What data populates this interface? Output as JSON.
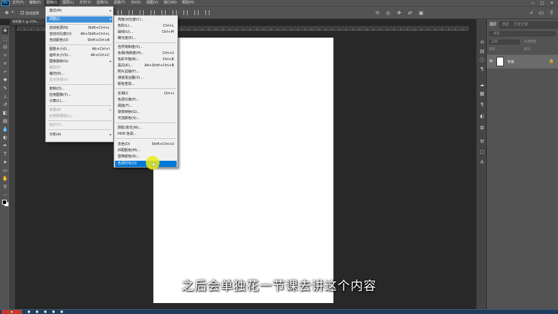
{
  "app": {
    "logo": "Ps",
    "doc_tab": "未标题-1 @ 25%..."
  },
  "menubar": {
    "items": [
      "文件(F)",
      "编辑(E)",
      "图像(I)",
      "图层(L)",
      "文字(Y)",
      "选择(S)",
      "滤镜(T)",
      "3D(D)",
      "视图(V)",
      "窗口(W)",
      "帮助(H)"
    ],
    "active_index": 2
  },
  "window_controls": {
    "minimize": "—",
    "maximize": "□",
    "close": "✕"
  },
  "options_bar": {
    "auto_select_label": "自动选择"
  },
  "image_menu": {
    "mode": "模式(M)",
    "adjustments": "调整(J)",
    "auto_tone": "自动色调(N)",
    "auto_tone_sc": "Shift+Ctrl+L",
    "auto_contrast": "自动对比度(U)",
    "auto_contrast_sc": "Alt+Shift+Ctrl+L",
    "auto_color": "自动颜色(O)",
    "auto_color_sc": "Shift+Ctrl+B",
    "image_size": "图像大小(I)...",
    "image_size_sc": "Alt+Ctrl+I",
    "canvas_size": "画布大小(S)...",
    "canvas_size_sc": "Alt+Ctrl+C",
    "rotation": "图像旋转(G)",
    "crop": "裁剪(P)",
    "trim": "裁切(R)...",
    "reveal_all": "显示全部(V)",
    "duplicate": "复制(D)...",
    "apply_image": "应用图像(Y)...",
    "calculations": "计算(C)...",
    "variables": "变量(B)",
    "apply_data": "应用数据组(L)...",
    "trap": "陷印(T)...",
    "analysis": "分析(A)"
  },
  "adjust_menu": {
    "brightness": "亮度/对比度(C)...",
    "levels": "色阶(L)...",
    "levels_sc": "Ctrl+L",
    "curves": "曲线(U)...",
    "curves_sc": "Ctrl+M",
    "exposure": "曝光度(E)...",
    "vibrance": "自然饱和度(V)...",
    "hue_sat": "色相/饱和度(H)...",
    "hue_sat_sc": "Ctrl+U",
    "color_balance": "色彩平衡(B)...",
    "color_balance_sc": "Ctrl+B",
    "bw": "黑白(K)...",
    "bw_sc": "Alt+Shift+Ctrl+B",
    "photo_filter": "照片滤镜(F)...",
    "channel_mixer": "通道混合器(X)...",
    "color_lookup": "颜色查找...",
    "invert": "反相(I)",
    "invert_sc": "Ctrl+I",
    "posterize": "色调分离(P)...",
    "threshold": "阈值(T)...",
    "gradient_map": "渐变映射(G)...",
    "selective_color": "可选颜色(S)...",
    "shadows": "阴影/高光(W)...",
    "hdr": "HDR 色调...",
    "desaturate": "去色(D)",
    "desaturate_sc": "Shift+Ctrl+U",
    "match_color": "匹配颜色(M)...",
    "replace_color": "替换颜色(R)...",
    "equalize": "色调均化(Q)"
  },
  "layers_panel": {
    "tabs": [
      "图层",
      "通道",
      "历史记录"
    ],
    "search": "类型",
    "mode": "正常",
    "opacity": "不透明度:",
    "lock": "锁定:",
    "fill": "填充:",
    "layer_name": "背景"
  },
  "subtitle": "之后会单独花一节课去讲这个内容",
  "colors": {
    "highlight": "#0078d7",
    "accent": "#31a8ff"
  }
}
